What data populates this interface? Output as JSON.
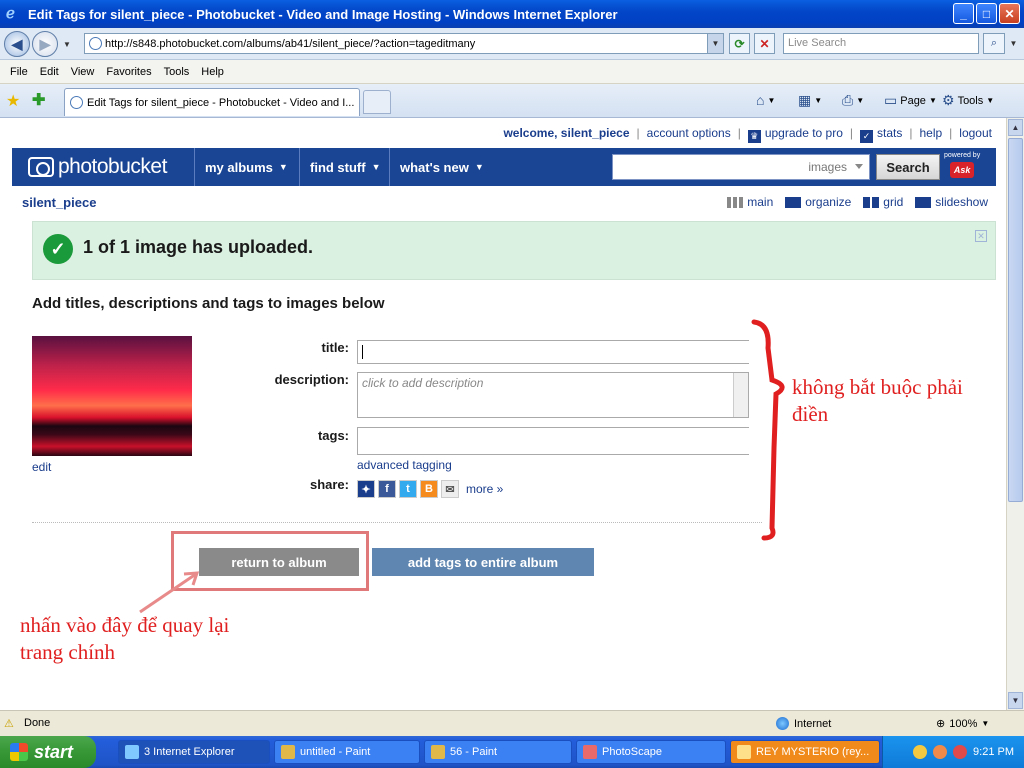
{
  "window": {
    "title": "Edit Tags for silent_piece - Photobucket - Video and Image Hosting - Windows Internet Explorer",
    "minimize": "_",
    "maximize": "□",
    "close": "✕"
  },
  "addressbar": {
    "url": "http://s848.photobucket.com/albums/ab41/silent_piece/?action=tageditmany",
    "search_placeholder": "Live Search"
  },
  "menu": [
    "File",
    "Edit",
    "View",
    "Favorites",
    "Tools",
    "Help"
  ],
  "tab": {
    "label": "Edit Tags for silent_piece - Photobucket - Video and I..."
  },
  "commandbar": {
    "page": "Page",
    "tools": "Tools"
  },
  "topnav": {
    "welcome": "welcome, silent_piece",
    "account": "account options",
    "upgrade": "upgrade to pro",
    "stats": "stats",
    "help": "help",
    "logout": "logout"
  },
  "photobucket": {
    "logo": "photobucket",
    "menu": [
      {
        "label": "my albums"
      },
      {
        "label": "find stuff"
      },
      {
        "label": "what's new"
      }
    ],
    "search_scope": "images",
    "search_button": "Search",
    "powered_by": "powered by",
    "ask": "Ask"
  },
  "album": {
    "username": "silent_piece",
    "views": [
      "main",
      "organize",
      "grid",
      "slideshow"
    ]
  },
  "upload": {
    "message": "1 of 1 image has uploaded."
  },
  "form": {
    "heading": "Add titles, descriptions and tags to images below",
    "edit_link": "edit",
    "title_label": "title:",
    "description_label": "description:",
    "description_placeholder": "click to add description",
    "tags_label": "tags:",
    "advanced_tagging": "advanced tagging",
    "share_label": "share:",
    "share_more": "more »",
    "return_button": "return to album",
    "add_tags_button": "add tags to entire album"
  },
  "annotations": {
    "right": "không bắt buộc phải điền",
    "left": "nhấn vào đây để quay lại trang chính"
  },
  "statusbar": {
    "status": "Done",
    "zone": "Internet",
    "zoom": "100%"
  },
  "taskbar": {
    "start": "start",
    "tasks": [
      {
        "label": "3 Internet Explorer"
      },
      {
        "label": "untitled - Paint"
      },
      {
        "label": "56 - Paint"
      },
      {
        "label": "PhotoScape"
      },
      {
        "label": "REY MYSTERIO (rey..."
      }
    ],
    "clock": "9:21 PM"
  },
  "colors": {
    "pb_blue": "#1a4594",
    "link": "#1a3d8c",
    "success_bg": "#daf0e0",
    "annotation_red": "#e02020"
  }
}
